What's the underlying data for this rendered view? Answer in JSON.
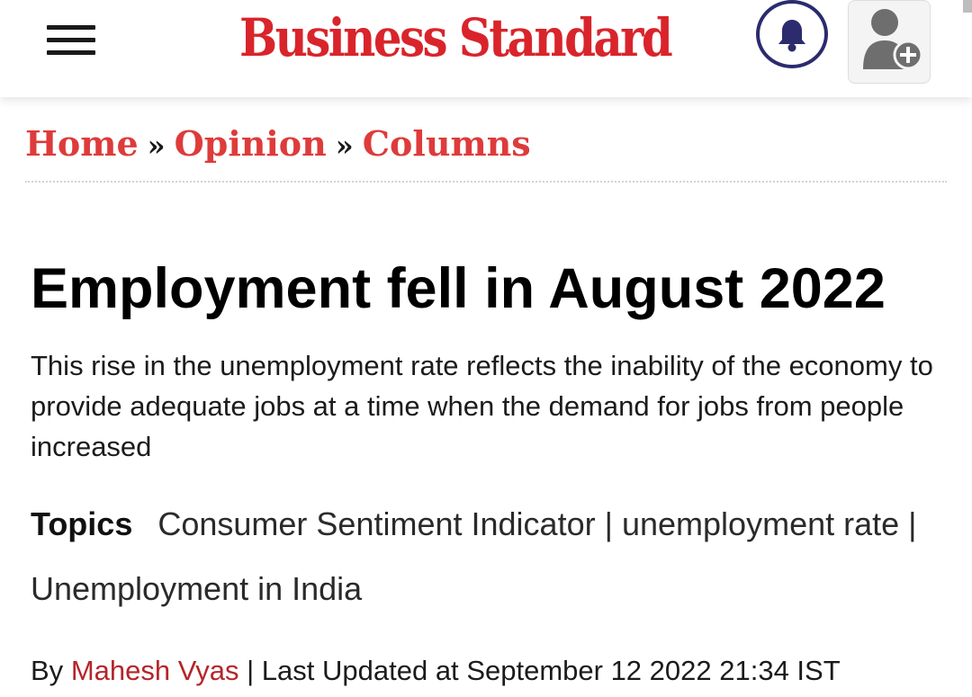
{
  "header": {
    "logo_text": "Business Standard",
    "brand_color": "#d9242b",
    "menu_icon": "hamburger-menu-icon",
    "notification_icon": "bell-icon",
    "profile_icon": "add-user-icon"
  },
  "breadcrumb": {
    "items": [
      "Home",
      "Opinion",
      "Columns"
    ],
    "separator": "»",
    "link_color": "#de3b3b"
  },
  "article": {
    "headline": "Employment fell in August 2022",
    "summary": "This rise in the unemployment rate reflects the inability of the economy to provide adequate jobs at a time when the demand for jobs from people increased",
    "topics": {
      "label": "Topics",
      "items": [
        "Consumer Sentiment Indicator",
        "unemployment rate",
        "Unemployment in India"
      ],
      "separator": "|"
    },
    "byline": {
      "by_label": "By",
      "author": "Mahesh Vyas",
      "separator": "|",
      "updated_label": "Last Updated at",
      "updated_datetime": "September 12 2022 21:34 IST"
    }
  }
}
